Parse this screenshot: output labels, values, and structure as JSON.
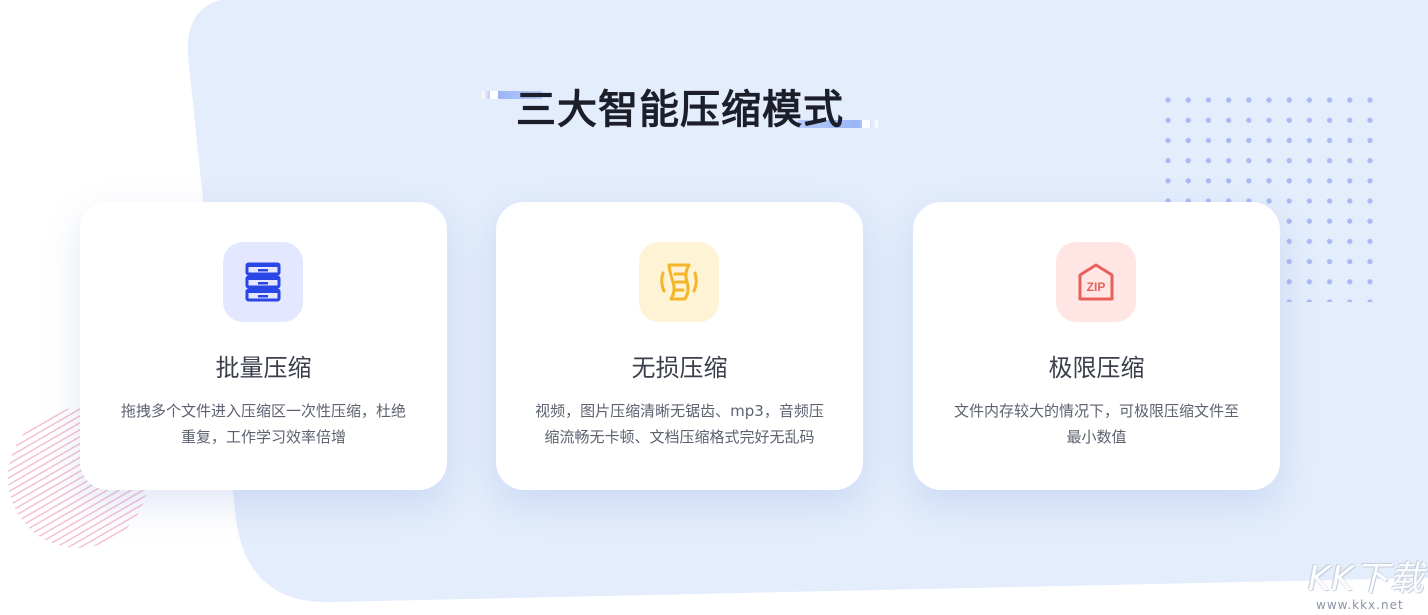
{
  "section": {
    "title": "三大智能压缩模式"
  },
  "cards": [
    {
      "icon": "server-stack-icon",
      "name": "批量压缩",
      "desc_line1": "拖拽多个文件进入压缩区一次性压缩，杜绝",
      "desc_line2": "重复，工作学习效率倍增",
      "tile_color": "#e3e7ff",
      "icon_color": "#2a46e6"
    },
    {
      "icon": "scroll-document-icon",
      "name": "无损压缩",
      "desc_line1": "视频，图片压缩清晰无锯齿、mp3，音频压",
      "desc_line2": "缩流畅无卡顿、文档压缩格式完好无乱码",
      "tile_color": "#fff3d6",
      "icon_color": "#f3b52a"
    },
    {
      "icon": "zip-file-icon",
      "name": "极限压缩",
      "desc_line1": "文件内存较大的情况下，可极限压缩文件至",
      "desc_line2": "最小数值",
      "tile_color": "#ffe6e4",
      "icon_color": "#e8605a"
    }
  ],
  "watermark": {
    "main": "KK下载",
    "sub": "www.kkx.net"
  },
  "colors": {
    "background_blob": "#e3edfc",
    "title": "#1c1f2a",
    "dot_pattern": "#aab9f4",
    "stripe_circle": "#f6bdd0"
  }
}
